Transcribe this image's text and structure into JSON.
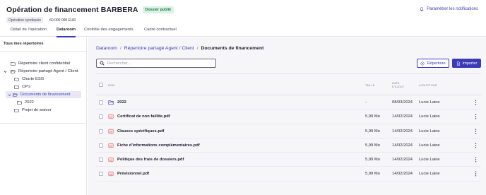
{
  "header": {
    "title": "Opération de financement BARBERA",
    "status_badge": "Dossier publié",
    "operation_type": "Opération syndiquée",
    "amount": "60 000 000 EUR",
    "notifications_label": "Paramétrer les notifications"
  },
  "tabs": [
    {
      "label": "Détail de l'opération",
      "active": false
    },
    {
      "label": "Dataroom",
      "active": true
    },
    {
      "label": "Contrôle des engagements",
      "active": false
    },
    {
      "label": "Cadre contractuel",
      "active": false
    }
  ],
  "sidebar": {
    "heading": "Tous mes répertoires",
    "items": [
      {
        "label": "Répertoire client confidentiel",
        "level": 0,
        "expanded": false,
        "has_children": false
      },
      {
        "label": "Répertoire partagé Agent / Client",
        "level": 0,
        "expanded": true,
        "has_children": true
      },
      {
        "label": "Charte ESG",
        "level": 1,
        "expanded": false,
        "has_children": false
      },
      {
        "label": "CP's",
        "level": 1,
        "expanded": false,
        "has_children": false
      },
      {
        "label": "Documents de financement",
        "level": 1,
        "expanded": true,
        "has_children": true,
        "selected": true
      },
      {
        "label": "2022",
        "level": 2,
        "expanded": false,
        "has_children": false
      },
      {
        "label": "Projet de waiver",
        "level": 1,
        "expanded": false,
        "has_children": false
      }
    ]
  },
  "breadcrumb": {
    "items": [
      "Dataroom",
      "Répertoire partagé Agent / Client",
      "Documents de financement"
    ],
    "separator": "/"
  },
  "search": {
    "placeholder": "Rechercher...",
    "value": ""
  },
  "actions": {
    "folder_button": "Répertoire",
    "import_button": "Importer"
  },
  "table": {
    "columns": {
      "name": "NOM",
      "size": "TAILLE",
      "date_line1": "DATE",
      "date_line2": "D'AJOUT",
      "added_by": "AJOUTÉ PAR"
    },
    "rows": [
      {
        "type": "folder",
        "name": "2022",
        "size": "-",
        "date": "08/03/2024",
        "added_by": "Lucie Laine"
      },
      {
        "type": "pdf",
        "name": "Certificat de non faillite.pdf",
        "size": "5,99 Mo",
        "date": "14/02/2024",
        "added_by": "Lucie Laine"
      },
      {
        "type": "pdf",
        "name": "Clauses spécifiques.pdf",
        "size": "5,99 Mo",
        "date": "14/02/2024",
        "added_by": "Lucie Laine"
      },
      {
        "type": "pdf",
        "name": "Fiche d'informations complémentaires.pdf",
        "size": "5,99 Mo",
        "date": "14/02/2024",
        "added_by": "Lucie Laine"
      },
      {
        "type": "pdf",
        "name": "Politique des frais de dossiers.pdf",
        "size": "5,99 Mo",
        "date": "14/02/2024",
        "added_by": "Lucie Laine"
      },
      {
        "type": "pdf",
        "name": "Prévisionnel.pdf",
        "size": "5,99 Mo",
        "date": "14/02/2024",
        "added_by": "Lucie Laine"
      }
    ]
  },
  "colors": {
    "accent": "#3b3bb8",
    "published_bg": "#d9f2e3",
    "published_text": "#1d7a45",
    "pdf_icon": "#d9534f",
    "main_bg": "#f6f6f9"
  },
  "icons": {
    "notifications": "bell-icon",
    "folder": "folder-icon",
    "pdf": "pdf-file-icon",
    "search": "search-icon",
    "row_menu": "kebab-menu-icon"
  }
}
